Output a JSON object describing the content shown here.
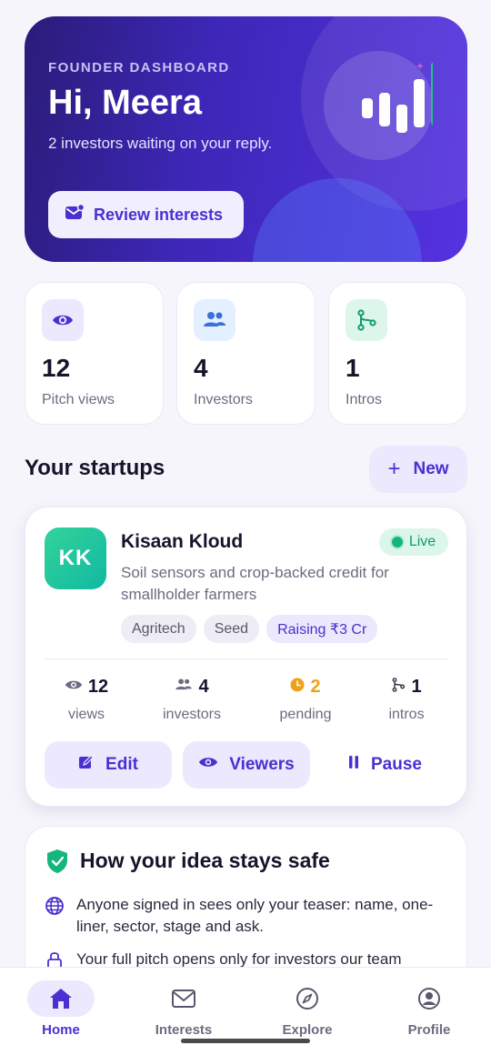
{
  "hero": {
    "eyebrow": "FOUNDER DASHBOARD",
    "greeting": "Hi, Meera",
    "subtitle": "2 investors waiting on your reply.",
    "review_label": "Review interests"
  },
  "stats": [
    {
      "value": "12",
      "label": "Pitch views",
      "icon": "eye-icon"
    },
    {
      "value": "4",
      "label": "Investors",
      "icon": "users-icon"
    },
    {
      "value": "1",
      "label": "Intros",
      "icon": "branch-icon"
    }
  ],
  "startups_section": {
    "title": "Your startups",
    "new_label": "New"
  },
  "startup": {
    "initials": "KK",
    "name": "Kisaan Kloud",
    "status": "Live",
    "description": "Soil sensors and crop-backed credit for smallholder farmers",
    "tags": [
      "Agritech",
      "Seed",
      "Raising ₹3 Cr"
    ],
    "metrics": [
      {
        "value": "12",
        "label": "views"
      },
      {
        "value": "4",
        "label": "investors"
      },
      {
        "value": "2",
        "label": "pending"
      },
      {
        "value": "1",
        "label": "intros"
      }
    ],
    "actions": {
      "edit": "Edit",
      "viewers": "Viewers",
      "pause": "Pause"
    }
  },
  "safety": {
    "title": "How your idea stays safe",
    "items": [
      "Anyone signed in sees only your teaser: name, one-liner, sector, stage and ask.",
      "Your full pitch opens only for investors our team"
    ]
  },
  "nav": [
    {
      "label": "Home",
      "active": true
    },
    {
      "label": "Interests",
      "active": false
    },
    {
      "label": "Explore",
      "active": false
    },
    {
      "label": "Profile",
      "active": false
    }
  ],
  "colors": {
    "accent": "#4b2fd0",
    "accent_soft": "#ece8fd",
    "live_green": "#15b57b",
    "pending_amber": "#f0a11c",
    "background": "#f6f5fb"
  }
}
